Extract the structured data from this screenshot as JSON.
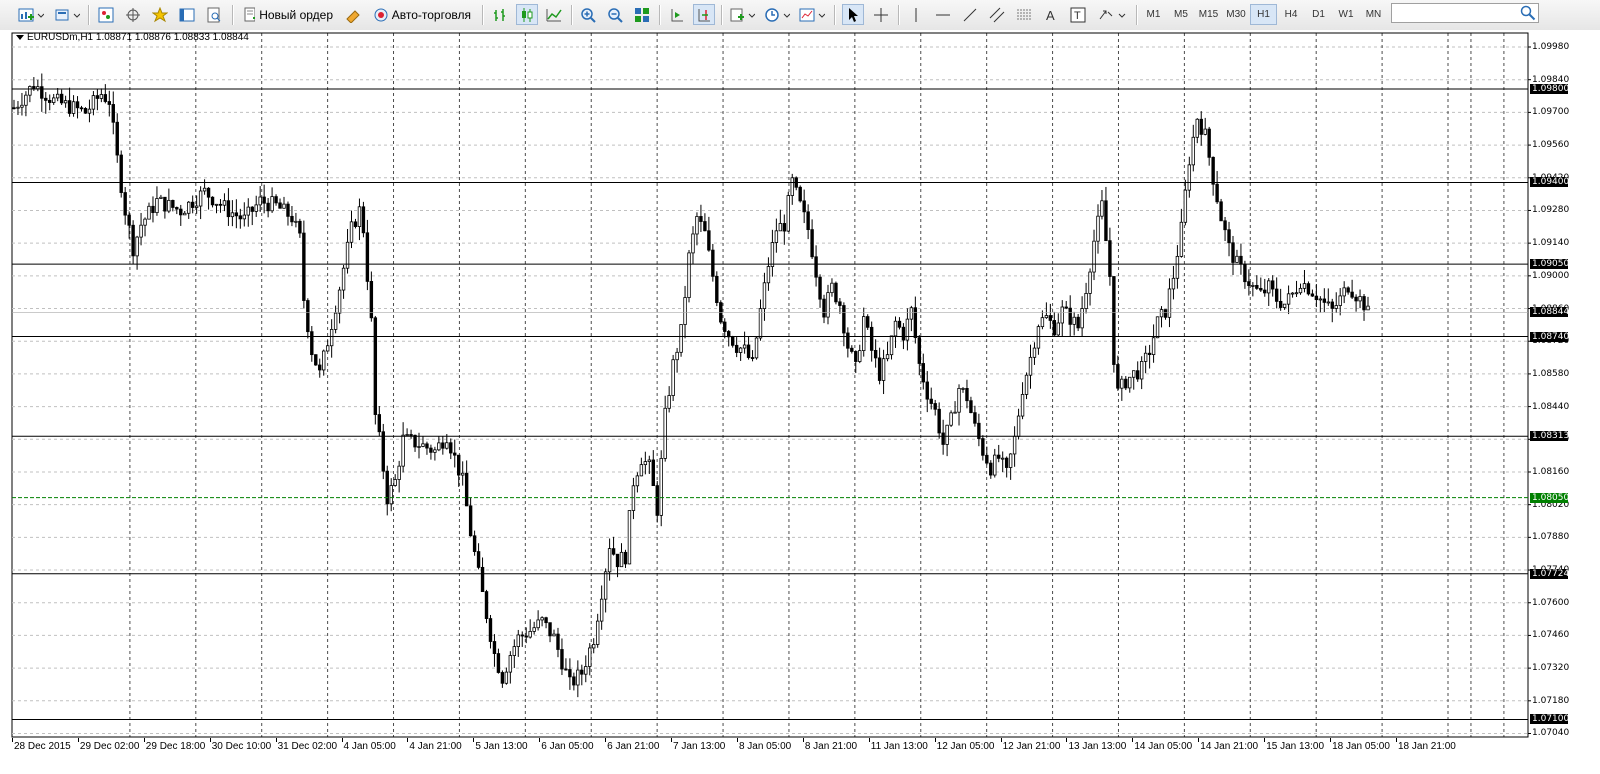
{
  "toolbar": {
    "new_order_label": "Новый ордер",
    "autotrading_label": "Авто-торговля",
    "timeframes": [
      "M1",
      "M5",
      "M15",
      "M30",
      "H1",
      "H4",
      "D1",
      "W1",
      "MN"
    ],
    "active_timeframe": "H1",
    "search_value": ""
  },
  "chart": {
    "symbol_line": "EURUSDm,H1  1.08871 1.08876 1.08833 1.08844",
    "price_scale": [
      "1.09980",
      "1.09840",
      "1.09700",
      "1.09560",
      "1.09420",
      "1.09280",
      "1.09140",
      "1.09000",
      "1.08860",
      "1.08720",
      "1.08580",
      "1.08440",
      "1.08300",
      "1.08160",
      "1.08020",
      "1.07880",
      "1.07740",
      "1.07600",
      "1.07460",
      "1.07320",
      "1.07180",
      "1.07040"
    ],
    "time_labels": [
      "28 Dec 2015",
      "29 Dec 02:00",
      "29 Dec 18:00",
      "30 Dec 10:00",
      "31 Dec 02:00",
      "4 Jan 05:00",
      "4 Jan 21:00",
      "5 Jan 13:00",
      "6 Jan 05:00",
      "6 Jan 21:00",
      "7 Jan 13:00",
      "8 Jan 05:00",
      "8 Jan 21:00",
      "11 Jan 13:00",
      "12 Jan 05:00",
      "12 Jan 21:00",
      "13 Jan 13:00",
      "14 Jan 05:00",
      "14 Jan 21:00",
      "15 Jan 13:00",
      "18 Jan 05:00",
      "18 Jan 21:00"
    ],
    "horizontal_lines": [
      {
        "price": "1.09800",
        "color": "#000000"
      },
      {
        "price": "1.09400",
        "color": "#000000"
      },
      {
        "price": "1.09050",
        "color": "#000000"
      },
      {
        "price": "1.08740",
        "color": "#000000"
      },
      {
        "price": "1.08313",
        "color": "#000000"
      },
      {
        "price": "1.07724",
        "color": "#000000"
      },
      {
        "price": "1.07100",
        "color": "#000000"
      }
    ],
    "bid_line": {
      "price": "1.08050",
      "color": "#008000"
    },
    "current_price": "1.08844",
    "anchors": [
      [
        0,
        1.0972
      ],
      [
        5,
        1.0982
      ],
      [
        10,
        1.0975
      ],
      [
        18,
        1.097
      ],
      [
        22,
        1.0978
      ],
      [
        24,
        1.0975
      ],
      [
        26,
        1.095
      ],
      [
        28,
        1.0928
      ],
      [
        30,
        1.0912
      ],
      [
        32,
        1.0922
      ],
      [
        36,
        1.0932
      ],
      [
        42,
        1.0928
      ],
      [
        48,
        1.0936
      ],
      [
        54,
        1.0928
      ],
      [
        58,
        1.0924
      ],
      [
        62,
        1.0932
      ],
      [
        66,
        1.093
      ],
      [
        70,
        1.0925
      ],
      [
        72,
        1.0916
      ],
      [
        73,
        1.089
      ],
      [
        75,
        1.0868
      ],
      [
        77,
        1.0858
      ],
      [
        79,
        1.0872
      ],
      [
        82,
        1.0895
      ],
      [
        85,
        1.092
      ],
      [
        87,
        1.0928
      ],
      [
        88,
        1.092
      ],
      [
        90,
        1.088
      ],
      [
        91,
        1.084
      ],
      [
        92,
        1.083
      ],
      [
        94,
        1.0805
      ],
      [
        96,
        1.0812
      ],
      [
        98,
        1.083
      ],
      [
        102,
        1.0828
      ],
      [
        106,
        1.0825
      ],
      [
        109,
        1.0832
      ],
      [
        111,
        1.0822
      ],
      [
        113,
        1.0812
      ],
      [
        115,
        1.079
      ],
      [
        117,
        1.0772
      ],
      [
        119,
        1.0755
      ],
      [
        121,
        1.0738
      ],
      [
        123,
        1.0728
      ],
      [
        125,
        1.0738
      ],
      [
        127,
        1.0745
      ],
      [
        130,
        1.0748
      ],
      [
        133,
        1.0752
      ],
      [
        136,
        1.0745
      ],
      [
        138,
        1.0735
      ],
      [
        140,
        1.0725
      ],
      [
        143,
        1.073
      ],
      [
        146,
        1.0745
      ],
      [
        148,
        1.0765
      ],
      [
        150,
        1.0785
      ],
      [
        152,
        1.0778
      ],
      [
        154,
        1.078
      ],
      [
        156,
        1.0812
      ],
      [
        158,
        1.0822
      ],
      [
        160,
        1.0818
      ],
      [
        162,
        1.08
      ],
      [
        164,
        1.084
      ],
      [
        166,
        1.0862
      ],
      [
        168,
        1.0876
      ],
      [
        170,
        1.0908
      ],
      [
        172,
        1.0925
      ],
      [
        174,
        1.0918
      ],
      [
        176,
        1.09
      ],
      [
        178,
        1.0882
      ],
      [
        180,
        1.0875
      ],
      [
        182,
        1.087
      ],
      [
        184,
        1.0868
      ],
      [
        186,
        1.0862
      ],
      [
        188,
        1.0885
      ],
      [
        190,
        1.0905
      ],
      [
        192,
        1.092
      ],
      [
        194,
        1.0922
      ],
      [
        196,
        1.094
      ],
      [
        198,
        1.093
      ],
      [
        200,
        1.092
      ],
      [
        202,
        1.0902
      ],
      [
        204,
        1.0885
      ],
      [
        206,
        1.0895
      ],
      [
        208,
        1.0888
      ],
      [
        210,
        1.087
      ],
      [
        212,
        1.086
      ],
      [
        214,
        1.0882
      ],
      [
        216,
        1.0868
      ],
      [
        218,
        1.0858
      ],
      [
        220,
        1.0865
      ],
      [
        222,
        1.088
      ],
      [
        224,
        1.0875
      ],
      [
        226,
        1.0885
      ],
      [
        228,
        1.0862
      ],
      [
        230,
        1.085
      ],
      [
        232,
        1.0842
      ],
      [
        234,
        1.0828
      ],
      [
        236,
        1.0838
      ],
      [
        238,
        1.0852
      ],
      [
        240,
        1.0848
      ],
      [
        242,
        1.0835
      ],
      [
        244,
        1.0825
      ],
      [
        246,
        1.0818
      ],
      [
        248,
        1.0822
      ],
      [
        250,
        1.0815
      ],
      [
        252,
        1.083
      ],
      [
        254,
        1.0852
      ],
      [
        256,
        1.0865
      ],
      [
        258,
        1.088
      ],
      [
        260,
        1.0882
      ],
      [
        262,
        1.0878
      ],
      [
        264,
        1.0885
      ],
      [
        266,
        1.0882
      ],
      [
        268,
        1.0878
      ],
      [
        270,
        1.0895
      ],
      [
        272,
        1.0915
      ],
      [
        274,
        1.093
      ],
      [
        276,
        1.09
      ],
      [
        277,
        1.0865
      ],
      [
        278,
        1.085
      ],
      [
        280,
        1.0855
      ],
      [
        282,
        1.0858
      ],
      [
        284,
        1.086
      ],
      [
        286,
        1.0868
      ],
      [
        288,
        1.088
      ],
      [
        290,
        1.0885
      ],
      [
        292,
        1.09
      ],
      [
        294,
        1.092
      ],
      [
        296,
        1.095
      ],
      [
        298,
        1.0968
      ],
      [
        300,
        1.096
      ],
      [
        302,
        1.0942
      ],
      [
        304,
        1.0925
      ],
      [
        306,
        1.0912
      ],
      [
        308,
        1.0905
      ],
      [
        310,
        1.09
      ],
      [
        312,
        1.0895
      ],
      [
        314,
        1.0892
      ],
      [
        316,
        1.0895
      ],
      [
        318,
        1.089
      ],
      [
        320,
        1.0888
      ],
      [
        322,
        1.0892
      ],
      [
        324,
        1.0898
      ],
      [
        326,
        1.0895
      ],
      [
        328,
        1.0892
      ],
      [
        330,
        1.0888
      ],
      [
        332,
        1.0885
      ],
      [
        334,
        1.089
      ],
      [
        336,
        1.0896
      ],
      [
        338,
        1.0892
      ],
      [
        340,
        1.0888
      ],
      [
        341,
        1.0884
      ]
    ]
  },
  "colors": {
    "candle": "#000000",
    "grid": "#c0c0c0",
    "bid": "#008000",
    "chart_bg": "#ffffff"
  }
}
